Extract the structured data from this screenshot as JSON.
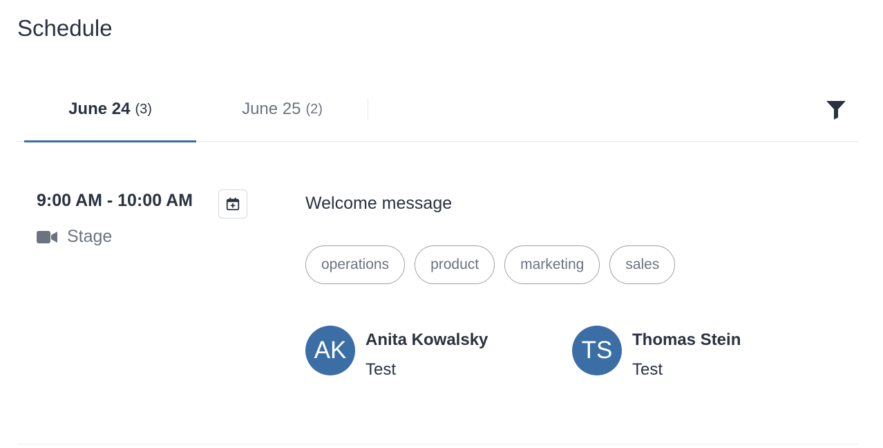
{
  "page": {
    "title": "Schedule"
  },
  "tabs": [
    {
      "label": "June 24",
      "count": "(3)",
      "active": true
    },
    {
      "label": "June 25",
      "count": "(2)",
      "active": false
    }
  ],
  "icons": {
    "filter": "filter-icon",
    "calendar_add": "calendar-plus-icon",
    "location": "video-camera-icon"
  },
  "session": {
    "time": "9:00 AM - 10:00 AM",
    "location": "Stage",
    "title": "Welcome message",
    "tags": [
      "operations",
      "product",
      "marketing",
      "sales"
    ],
    "speakers": [
      {
        "initials": "AK",
        "name": "Anita Kowalsky",
        "role": "Test"
      },
      {
        "initials": "TS",
        "name": "Thomas Stein",
        "role": "Test"
      }
    ]
  },
  "colors": {
    "accent": "#3a6ea5",
    "text": "#2a3140",
    "muted": "#6b7280",
    "border": "#e6e8ec"
  }
}
